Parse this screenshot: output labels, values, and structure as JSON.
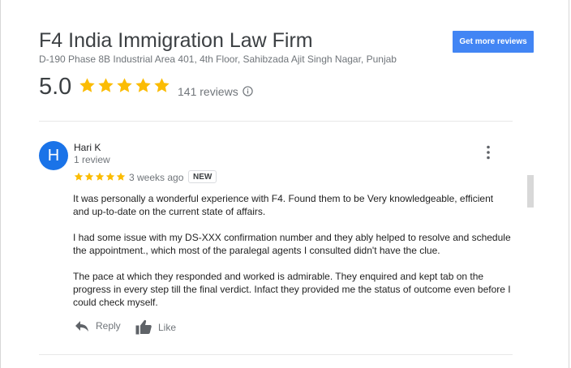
{
  "business": {
    "name": "F4 India Immigration Law Firm",
    "address": "D-190 Phase 8B Industrial Area 401, 4th Floor, Sahibzada Ajit Singh Nagar, Punjab",
    "rating": "5.0",
    "stars": 5,
    "review_count": "141 reviews"
  },
  "actions": {
    "get_more_reviews": "Get more reviews"
  },
  "review": {
    "avatar_letter": "H",
    "author": "Hari K",
    "author_meta": "1 review",
    "stars": 5,
    "time_ago": "3 weeks ago",
    "badge": "NEW",
    "paragraphs": [
      "It was personally a wonderful experience with F4. Found them to be Very knowledgeable, efficient and up-to-date on the current state of affairs.",
      "I had some issue with my DS-XXX confirmation number and they ably helped to resolve and schedule the appointment., which most of the paralegal agents I consulted didn't have the clue.",
      "The pace at which they responded and worked is admirable. They enquired and kept tab on the progress in every step till the final verdict. Infact they provided me the status of outcome even before I could check myself."
    ],
    "reply_label": "Reply",
    "like_label": "Like"
  },
  "colors": {
    "accent": "#4285f4",
    "star": "#fbbc04",
    "avatar": "#1a73e8"
  },
  "icons": [
    "star-icon",
    "info-icon",
    "more-vert-icon",
    "reply-icon",
    "thumb-up-icon"
  ]
}
